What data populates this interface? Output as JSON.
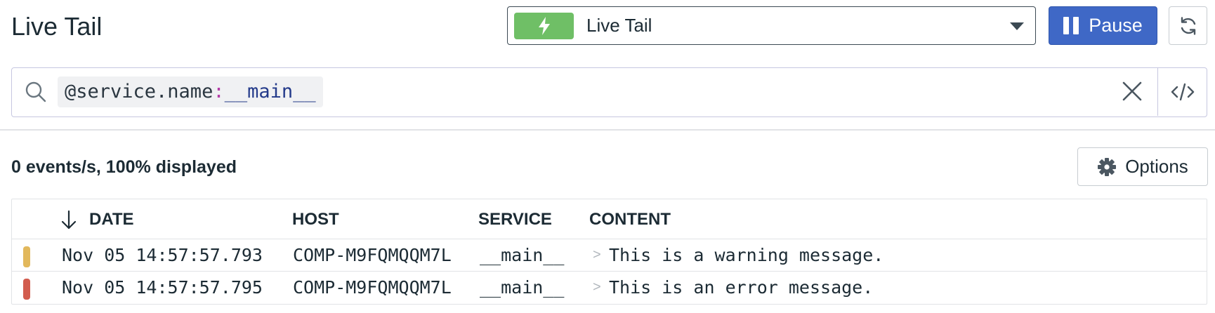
{
  "header": {
    "title": "Live Tail"
  },
  "mode_select": {
    "label": "Live Tail",
    "icon": "lightning-bolt-icon",
    "badge_color": "#6fbf66"
  },
  "pause_button": {
    "label": "Pause",
    "color": "#3f68c6"
  },
  "search": {
    "attribute": "@service.name",
    "separator": ":",
    "value": "__main__"
  },
  "status": {
    "text": "0 events/s, 100% displayed"
  },
  "options_button": {
    "label": "Options"
  },
  "table": {
    "columns": [
      "DATE",
      "HOST",
      "SERVICE",
      "CONTENT"
    ],
    "sort": "descending",
    "rows": [
      {
        "level": "warning",
        "color": "#e2b85c",
        "date": "Nov 05 14:57:57.793",
        "host": "COMP-M9FQMQQM7L",
        "service": "__main__",
        "content": "This is a warning message."
      },
      {
        "level": "error",
        "color": "#d25c4e",
        "date": "Nov 05 14:57:57.795",
        "host": "COMP-M9FQMQQM7L",
        "service": "__main__",
        "content": "This is an error message."
      }
    ]
  }
}
